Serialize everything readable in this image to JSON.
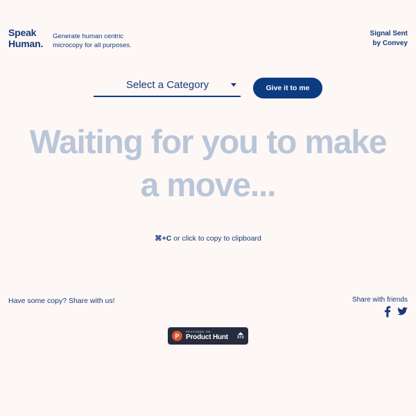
{
  "header": {
    "logo": "Speak\nHuman.",
    "tagline": "Generate human centric\nmicrocopy for all purposes.",
    "signal": "Signal Sent\nby Convey"
  },
  "controls": {
    "category_select": {
      "selected": "Select a Category",
      "caret_icon": "chevron-down-icon"
    },
    "cta_label": "Give it to me"
  },
  "main": {
    "hero_text": "Waiting for you to make a move...",
    "copy_hint_shortcut": "⌘+C",
    "copy_hint_rest": " or click to copy to clipboard"
  },
  "footer": {
    "share_copy_link": "Have some copy? Share with us!",
    "share_friends_label": "Share with friends",
    "social": [
      {
        "name": "facebook-icon"
      },
      {
        "name": "twitter-icon"
      }
    ],
    "product_hunt": {
      "featured_label": "FEATURED ON",
      "name": "Product Hunt",
      "logo_letter": "P",
      "votes": "372"
    }
  },
  "colors": {
    "background": "#fdf8f6",
    "brand_navy": "#0d3b82",
    "text_navy": "#17387a",
    "hero_muted": "#b9c6d8",
    "ph_dark": "#262b3d",
    "ph_orange": "#da552f"
  }
}
